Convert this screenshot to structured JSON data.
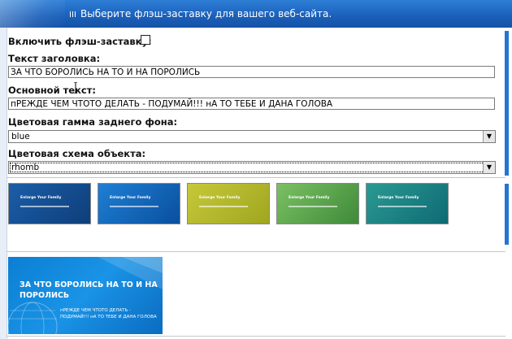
{
  "header": {
    "hint": "Выберите флэш-заставку для вашего веб-сайта."
  },
  "form": {
    "enable_label": "Включить флэш-заставку:",
    "title_label": "Текст заголовка:",
    "title_value": "ЗА ЧТО БОРОЛИСЬ НА ТО И НА ПОРОЛИСЬ",
    "main_label": "Основной текст:",
    "main_value": "пРЕЖДЕ ЧЕМ ЧТОТО ДЕЛАТЬ - ПОДУМАЙ!!! нА ТО ТЕБЕ И ДАНА ГОЛОВА",
    "bg_label": "Цветовая гамма заднего фона:",
    "bg_value": "blue",
    "scheme_label": "Цветовая схема объекта:",
    "scheme_value": "rhomb"
  },
  "thumbnails": [
    {
      "text": "Enlarge Your Family",
      "color_from": "#1b5ea8",
      "color_to": "#0e3e7a"
    },
    {
      "text": "Enlarge Your Family",
      "color_from": "#1f7fd4",
      "color_to": "#0a4f9e"
    },
    {
      "text": "Enlarge Your Family",
      "color_from": "#c7c83a",
      "color_to": "#9fa620"
    },
    {
      "text": "Enlarge Your Family",
      "color_from": "#7cc063",
      "color_to": "#3e8a3a"
    },
    {
      "text": "Enlarge Your Family",
      "color_from": "#2a9a93",
      "color_to": "#0f6a73"
    }
  ],
  "preview": {
    "title": "ЗА ЧТО БОРОЛИСЬ НА ТО И НА ПОРОЛИСЬ",
    "text": "пРЕЖДЕ ЧЕМ ЧТОТО ДЕЛАТЬ - ПОДУМАЙ!!! нА ТО ТЕБЕ И ДАНА ГОЛОВА"
  }
}
